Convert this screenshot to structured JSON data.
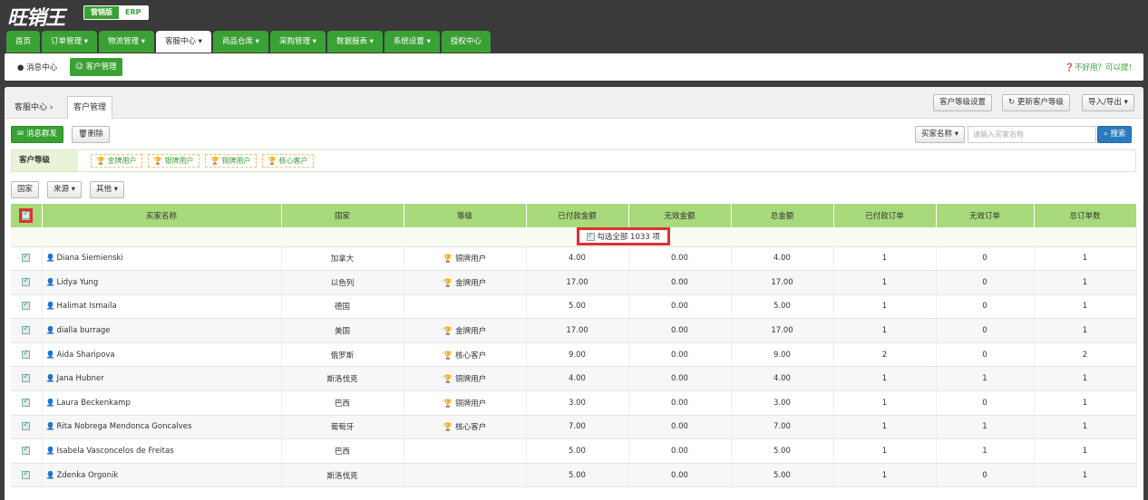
{
  "app": {
    "logo": "旺销王",
    "switch_active": "营销版",
    "switch_other": "ERP"
  },
  "nav": {
    "tabs": [
      "首页",
      "订单管理 ▾",
      "物流管理 ▾",
      "客服中心 ▾",
      "商品仓库 ▾",
      "采购管理 ▾",
      "数据报表 ▾",
      "系统设置 ▾",
      "授权中心"
    ],
    "active_index": 3
  },
  "subnav": {
    "message_center": "消息中心",
    "customer_mgmt": "客户管理",
    "help": "不好用？可以提！"
  },
  "breadcrumb": {
    "parent": "客服中心",
    "current": "客户管理"
  },
  "header_buttons": {
    "level_settings": "客户等级设置",
    "update_level": "更新客户等级",
    "import_export": "导入/导出 ▾"
  },
  "toolbar": {
    "bulk_message": "消息群发",
    "delete": "删除",
    "buyer_name_select": "买家名称 ▾",
    "search_placeholder": "请输入买家名称",
    "search_button": "搜索"
  },
  "levels": {
    "label": "客户等级",
    "chips": [
      "金牌用户",
      "银牌用户",
      "铜牌用户",
      "核心客户"
    ]
  },
  "filters": [
    "国家",
    "来源 ▾",
    "其他 ▾"
  ],
  "table": {
    "columns": [
      "买家名称",
      "国家",
      "等级",
      "已付款金额",
      "无效金额",
      "总金额",
      "已付款订单",
      "无效订单",
      "总订单数"
    ],
    "select_all_text": "勾选全部 1033 项",
    "rows": [
      {
        "name": "Diana Siemienski",
        "country": "加拿大",
        "level": "铜牌用户",
        "level_type": "bronze",
        "paid": "4.00",
        "invalid": "0.00",
        "total": "4.00",
        "paid_orders": "1",
        "invalid_orders": "0",
        "total_orders": "1"
      },
      {
        "name": "Lidya Yung",
        "country": "以色列",
        "level": "金牌用户",
        "level_type": "gold",
        "paid": "17.00",
        "invalid": "0.00",
        "total": "17.00",
        "paid_orders": "1",
        "invalid_orders": "0",
        "total_orders": "1"
      },
      {
        "name": "Halimat Ismaila",
        "country": "德国",
        "level": "",
        "level_type": "",
        "paid": "5.00",
        "invalid": "0.00",
        "total": "5.00",
        "paid_orders": "1",
        "invalid_orders": "0",
        "total_orders": "1"
      },
      {
        "name": "dialla burrage",
        "country": "美国",
        "level": "金牌用户",
        "level_type": "gold",
        "paid": "17.00",
        "invalid": "0.00",
        "total": "17.00",
        "paid_orders": "1",
        "invalid_orders": "0",
        "total_orders": "1"
      },
      {
        "name": "Aida Sharipova",
        "country": "俄罗斯",
        "level": "核心客户",
        "level_type": "gold",
        "paid": "9.00",
        "invalid": "0.00",
        "total": "9.00",
        "paid_orders": "2",
        "invalid_orders": "0",
        "total_orders": "2"
      },
      {
        "name": "Jana Hubner",
        "country": "斯洛伐克",
        "level": "铜牌用户",
        "level_type": "bronze",
        "paid": "4.00",
        "invalid": "0.00",
        "total": "4.00",
        "paid_orders": "1",
        "invalid_orders": "1",
        "total_orders": "1"
      },
      {
        "name": "Laura Beckenkamp",
        "country": "巴西",
        "level": "铜牌用户",
        "level_type": "bronze",
        "paid": "3.00",
        "invalid": "0.00",
        "total": "3.00",
        "paid_orders": "1",
        "invalid_orders": "0",
        "total_orders": "1"
      },
      {
        "name": "Rita Nobrega Mendonca Goncalves",
        "country": "葡萄牙",
        "level": "核心客户",
        "level_type": "gold",
        "paid": "7.00",
        "invalid": "0.00",
        "total": "7.00",
        "paid_orders": "1",
        "invalid_orders": "1",
        "total_orders": "1"
      },
      {
        "name": "Isabela Vasconcelos de Freitas",
        "country": "巴西",
        "level": "",
        "level_type": "",
        "paid": "5.00",
        "invalid": "0.00",
        "total": "5.00",
        "paid_orders": "1",
        "invalid_orders": "1",
        "total_orders": "1"
      },
      {
        "name": "Zdenka Orgonik",
        "country": "斯洛伐克",
        "level": "",
        "level_type": "",
        "paid": "5.00",
        "invalid": "0.00",
        "total": "5.00",
        "paid_orders": "1",
        "invalid_orders": "0",
        "total_orders": "1"
      }
    ]
  }
}
